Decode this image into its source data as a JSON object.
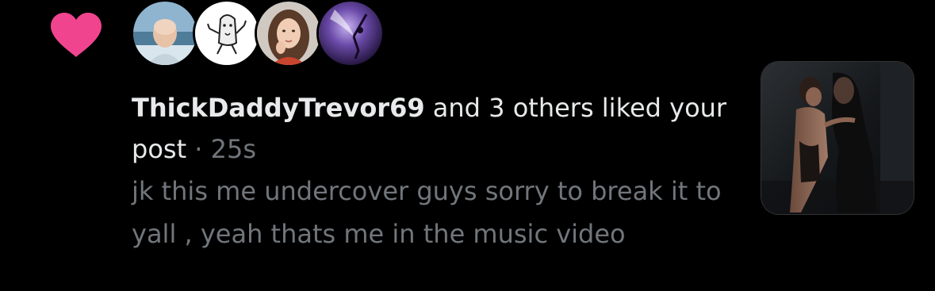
{
  "notification": {
    "type_icon": "heart-icon",
    "avatars": [
      {
        "name": "avatar-bald-man-beach"
      },
      {
        "name": "avatar-cartoon-doodle"
      },
      {
        "name": "avatar-girl-brown-hair"
      },
      {
        "name": "avatar-purple-dancer"
      }
    ],
    "username": "ThickDaddyTrevor69",
    "action_text": " and 3 others liked your post",
    "separator": " · ",
    "timestamp": "25s",
    "post_snippet": "jk this me undercover guys sorry to break it to yall , yeah thats me in the music video",
    "media_thumbnail": "post-media-thumbnail"
  },
  "colors": {
    "background": "#000000",
    "heart": "#f0448e",
    "primary_text": "#e7e9ea",
    "secondary_text": "#71767b"
  }
}
